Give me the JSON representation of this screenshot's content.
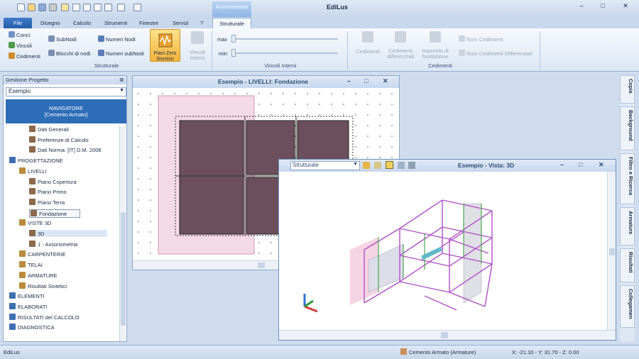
{
  "app": {
    "title": "EdiLus",
    "context_tab": "Assonometria"
  },
  "tabs": [
    "File",
    "Disegno",
    "Calcolo",
    "Strumenti",
    "Finestre",
    "Servizi",
    "?",
    "Strutturale"
  ],
  "ribbon": {
    "g1": {
      "label": "Strutturale",
      "items": [
        "Conci",
        "Vincoli",
        "Cedimenti",
        "SubNodi",
        "Blocchi di nodi",
        "Numeri Nodi",
        "Numeri subNodi"
      ],
      "big": "Piani Zero Sismico",
      "big2": "Vincoli Interni"
    },
    "g2": {
      "label": "Vincoli Interni",
      "max": "max",
      "min": "min"
    },
    "g3": {
      "label": "Cedimenti",
      "items": [
        "Cedimenti",
        "Cedimenti differenziali",
        "Impronta di fondazione"
      ],
      "right": [
        "Num Cedimenti",
        "Num Cedimenti Differenziali"
      ]
    }
  },
  "left": {
    "header": "Gestione Progetto",
    "combo": "Esempio",
    "nav_line1": "NAVIGATORE",
    "nav_line2": "[Cemento Armato]",
    "tree": [
      {
        "t": "Dati Generali",
        "l": 2
      },
      {
        "t": "Preferenze di Calcolo",
        "l": 2
      },
      {
        "t": "Dati Norma: [IT] D.M. 2008",
        "l": 2
      },
      {
        "t": "PROGETTAZIONE",
        "l": 0
      },
      {
        "t": "LIVELLI",
        "l": 1
      },
      {
        "t": "Piano Copertura",
        "l": 2
      },
      {
        "t": "Piano Primo",
        "l": 2
      },
      {
        "t": "Piano Terra",
        "l": 2
      },
      {
        "t": "Fondazione",
        "l": 2
      },
      {
        "t": "VISTE 3D",
        "l": 1
      },
      {
        "t": "3D",
        "l": 2
      },
      {
        "t": "1 - Assonometria",
        "l": 2
      },
      {
        "t": "CARPENTERIE",
        "l": 1
      },
      {
        "t": "TELAI",
        "l": 1
      },
      {
        "t": "ARMATURE",
        "l": 1
      },
      {
        "t": "Risultati Sintetici",
        "l": 1
      },
      {
        "t": "ELEMENTI",
        "l": 0
      },
      {
        "t": "ELABORATI",
        "l": 0
      },
      {
        "t": "RISULTATI del CALCOLO",
        "l": 0
      },
      {
        "t": "DIAGNOSTICA",
        "l": 0
      }
    ]
  },
  "plan": {
    "title": "Esempio - LIVELLI: Fondazione"
  },
  "view3d": {
    "title": "Esempio - Vista: 3D",
    "select": "Strutturale"
  },
  "right": [
    "Copia",
    "Background",
    "Filtro e Ricerca",
    "Armature",
    "Risultati",
    "Collegamen"
  ],
  "status": {
    "left": "EdiLus",
    "mode": "Cemento Armato (Armature)",
    "coords": "X: -21.10 - Y: 31.70 - Z: 0.00"
  },
  "colors": {
    "accent": "#2e6db8",
    "tabfile": "#245ea8",
    "slab": "#6b4f5c"
  }
}
